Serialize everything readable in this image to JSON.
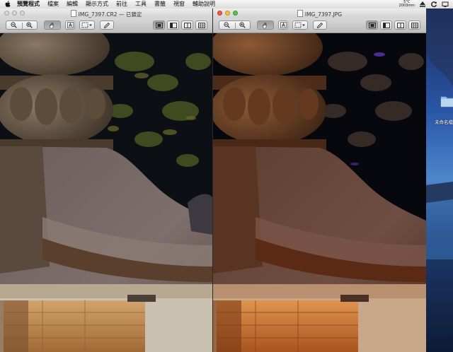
{
  "menubar": {
    "app_name": "預覽程式",
    "items": [
      "檔案",
      "編輯",
      "顯示方式",
      "前往",
      "工具",
      "書籤",
      "視窗",
      "輔助說明"
    ],
    "weather_temp": "5°C",
    "weather_place": "2003mm"
  },
  "windows": [
    {
      "title": "IMG_7397.CR2 — 已鎖定",
      "active": false
    },
    {
      "title": "IMG_7397.JPG",
      "active": true
    }
  ],
  "desktop": {
    "folder_label": "未命名檔"
  }
}
